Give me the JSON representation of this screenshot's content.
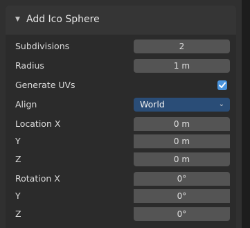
{
  "panel": {
    "title": "Add Ico Sphere",
    "collapse_glyph": "▼"
  },
  "fields": {
    "subdivisions": {
      "label": "Subdivisions",
      "value": "2"
    },
    "radius": {
      "label": "Radius",
      "value": "1 m"
    },
    "generate_uvs": {
      "label": "Generate UVs",
      "checked": true
    },
    "align": {
      "label": "Align",
      "value": "World",
      "chevron": "⌄"
    },
    "location": {
      "x": {
        "label": "Location X",
        "value": "0 m"
      },
      "y": {
        "label": "Y",
        "value": "0 m"
      },
      "z": {
        "label": "Z",
        "value": "0 m"
      }
    },
    "rotation": {
      "x": {
        "label": "Rotation X",
        "value": "0°"
      },
      "y": {
        "label": "Y",
        "value": "0°"
      },
      "z": {
        "label": "Z",
        "value": "0°"
      }
    }
  },
  "colors": {
    "accent": "#4a94dd",
    "select_bg": "#2a4d77",
    "field_bg": "#545454",
    "panel_bg": "#2b2b2b"
  }
}
